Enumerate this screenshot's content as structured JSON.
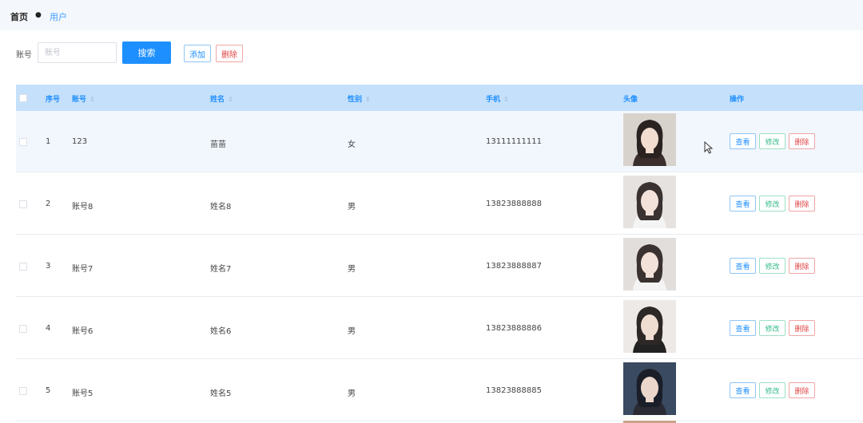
{
  "breadcrumb": {
    "home": "首页",
    "separator": "●",
    "current": "用户"
  },
  "search": {
    "label": "账号",
    "placeholder": "账号",
    "value": "",
    "search_button": "搜索",
    "add_button": "添加",
    "delete_button": "删除"
  },
  "table": {
    "headers": {
      "index": "序号",
      "account": "账号",
      "name": "姓名",
      "gender": "性别",
      "phone": "手机",
      "avatar": "头像",
      "actions": "操作"
    },
    "sort_icon": "⇕",
    "rows": [
      {
        "index": "1",
        "account": "123",
        "name": "苗苗",
        "gender": "女",
        "phone": "13111111111",
        "avatar": "avatar-photo"
      },
      {
        "index": "2",
        "account": "账号8",
        "name": "姓名8",
        "gender": "男",
        "phone": "13823888888",
        "avatar": "avatar-photo"
      },
      {
        "index": "3",
        "account": "账号7",
        "name": "姓名7",
        "gender": "男",
        "phone": "13823888887",
        "avatar": "avatar-photo"
      },
      {
        "index": "4",
        "account": "账号6",
        "name": "姓名6",
        "gender": "男",
        "phone": "13823888886",
        "avatar": "avatar-photo"
      },
      {
        "index": "5",
        "account": "账号5",
        "name": "姓名5",
        "gender": "男",
        "phone": "13823888885",
        "avatar": "avatar-photo"
      }
    ],
    "row_actions": {
      "view": "查看",
      "edit": "修改",
      "delete": "删除"
    }
  },
  "colors": {
    "primary": "#1e8fff",
    "header_bg": "#c5e0fb",
    "success": "#33bb88",
    "danger": "#e04444"
  }
}
